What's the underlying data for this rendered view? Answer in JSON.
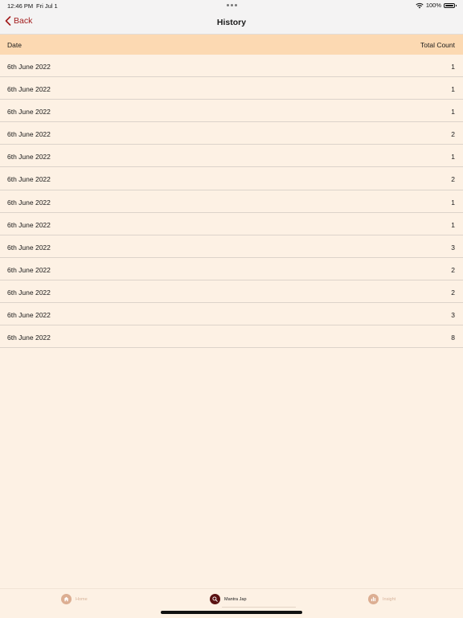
{
  "status_bar": {
    "time": "12:46 PM",
    "date": "Fri Jul 1",
    "battery": "100%"
  },
  "nav": {
    "back_label": "Back",
    "title": "History"
  },
  "table": {
    "headers": {
      "date": "Date",
      "count": "Total Count"
    },
    "rows": [
      {
        "date": "6th June 2022",
        "count": "1"
      },
      {
        "date": "6th June 2022",
        "count": "1"
      },
      {
        "date": "6th June 2022",
        "count": "1"
      },
      {
        "date": "6th June 2022",
        "count": "2"
      },
      {
        "date": "6th June 2022",
        "count": "1"
      },
      {
        "date": "6th June 2022",
        "count": "2"
      },
      {
        "date": "6th June 2022",
        "count": "1"
      },
      {
        "date": "6th June 2022",
        "count": "1"
      },
      {
        "date": "6th June 2022",
        "count": "3"
      },
      {
        "date": "6th June 2022",
        "count": "2"
      },
      {
        "date": "6th June 2022",
        "count": "2"
      },
      {
        "date": "6th June 2022",
        "count": "3"
      },
      {
        "date": "6th June 2022",
        "count": "8"
      }
    ]
  },
  "tabs": [
    {
      "label": "Home",
      "icon": "home-icon",
      "active": false
    },
    {
      "label": "Mantra Jap",
      "icon": "search-icon",
      "active": true
    },
    {
      "label": "Insight",
      "icon": "bar-chart-icon",
      "active": false
    }
  ],
  "colors": {
    "background": "#fdf1e4",
    "header_bg": "#fcd9b2",
    "accent": "#a21c1c",
    "active_tab_icon": "#5a1111",
    "inactive_tab": "#dcae92"
  }
}
